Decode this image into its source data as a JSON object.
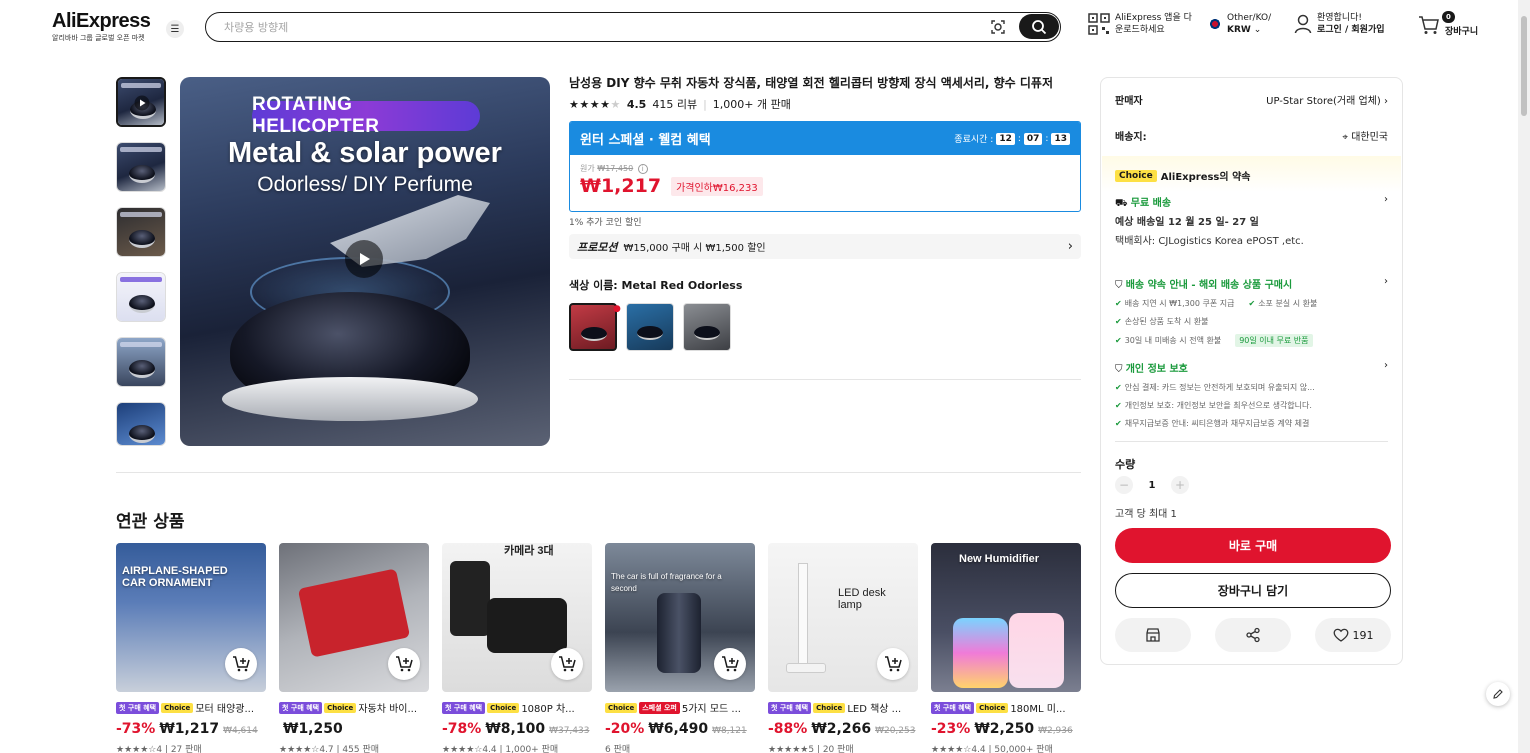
{
  "header": {
    "logo": "AliExpress",
    "logo_sub": "알리바바 그룹 글로벌 오픈 마켓",
    "search_placeholder": "차량용 방향제",
    "app_download": "AliExpress 앱을 다운로드하세요",
    "region_top": "Other/KO/",
    "region_currency": "KRW",
    "greeting": "환영합니다!",
    "login": "로그인 / 회원가입",
    "cart_count": "0",
    "cart_label": "장바구니"
  },
  "product": {
    "title": "남성용 DIY 향수 무취 자동차 장식품, 태양열 회전 헬리콥터 방향제 장식 액세서리, 향수 디퓨저",
    "rating": "4.5",
    "reviews": "415 리뷰",
    "sold": "1,000+ 개 판매",
    "deal_title": "윈터 스페셜 · 웰컴 혜택",
    "timer_label": "종료시간 :",
    "timer": [
      "12",
      "07",
      "13"
    ],
    "orig_label": "원가",
    "orig_price": "₩17,450",
    "price": "₩1,217",
    "discount": "가격인하₩16,233",
    "coin_note": "1% 추가 코인 할인",
    "promo_label": "프로모션",
    "promo_text": "₩15,000 구매 시 ₩1,500 할인",
    "color_label": "색상 이름: Metal Red Odorless",
    "image": {
      "badge": "ROTATING HELICOPTER",
      "title": "Metal & solar power",
      "subtitle": "Odorless/ DIY Perfume"
    }
  },
  "side": {
    "seller_label": "판매자",
    "seller_name": "UP-Star Store(거래 업체)",
    "ship_to_label": "배송지:",
    "ship_to": "대한민국",
    "choice_tag": "Choice",
    "promise": "AliExpress의 약속",
    "free_ship": "무료 배송",
    "eta": "예상 배송일 12 월 25 일- 27 일",
    "carrier": "택배회사: CJLogistics Korea ePOST ,etc.",
    "promise_title": "배송 약속 안내 - 해외 배송 상품 구매시",
    "promise_items": [
      "배송 지연 시 ₩1,300 쿠폰 지급",
      "소포 분실 시 환불",
      "손상된 상품 도착 시 환불",
      "30일 내 미배송 시 전액 환불"
    ],
    "return_tag": "90일 이내 무료 반품",
    "privacy_title": "개인 정보 보호",
    "privacy_items": [
      "안심 결제: 카드 정보는 안전하게 보호되며 유출되지 않...",
      "개인정보 보호: 개인정보 보안을 최우선으로 생각합니다.",
      "채무지급보증 안내: 씨티은행과 채무지급보증 계약 체결"
    ],
    "qty_label": "수량",
    "qty_value": "1",
    "qty_note": "고객 당 최대 1",
    "buy_now": "바로 구매",
    "add_cart": "장바구니 담기",
    "wish_count": "191"
  },
  "related": {
    "title": "연관 상품",
    "items": [
      {
        "img_text": "AIRPLANE-SHAPED CAR ORNAMENT",
        "tags": [
          "첫 구매 혜택",
          "Choice"
        ],
        "name": "모터 태양광...",
        "pct": "-73%",
        "price": "₩1,217",
        "orig": "₩4,614",
        "meta": "★★★★☆4 | 27 판매"
      },
      {
        "img_text": "",
        "tags": [
          "첫 구매 혜택",
          "Choice"
        ],
        "name": "자동차 바이...",
        "pct": "",
        "price": "₩1,250",
        "orig": "",
        "meta": "★★★★☆4.7 | 455 판매"
      },
      {
        "img_text": "카메라 3대",
        "tags": [
          "첫 구매 혜택",
          "Choice"
        ],
        "name": "1080P 차...",
        "pct": "-78%",
        "price": "₩8,100",
        "orig": "₩37,433",
        "meta": "★★★★☆4.4 | 1,000+ 판매"
      },
      {
        "img_text": "The car is full of fragrance for a second",
        "tags": [
          "Choice",
          "스페셜 오퍼"
        ],
        "name": "5가지 모드 ...",
        "pct": "-20%",
        "price": "₩6,490",
        "orig": "₩8,121",
        "meta": "6 판매"
      },
      {
        "img_text": "LED desk lamp",
        "tags": [
          "첫 구매 혜택",
          "Choice"
        ],
        "name": "LED 책상 ...",
        "pct": "-88%",
        "price": "₩2,266",
        "orig": "₩20,253",
        "meta": "★★★★★5 | 20 판매"
      },
      {
        "img_text": "New Humidifier",
        "tags": [
          "첫 구매 혜택",
          "Choice"
        ],
        "name": "180ML 미...",
        "pct": "-23%",
        "price": "₩2,250",
        "orig": "₩2,936",
        "meta": "★★★★☆4.4 | 50,000+ 판매"
      }
    ]
  }
}
